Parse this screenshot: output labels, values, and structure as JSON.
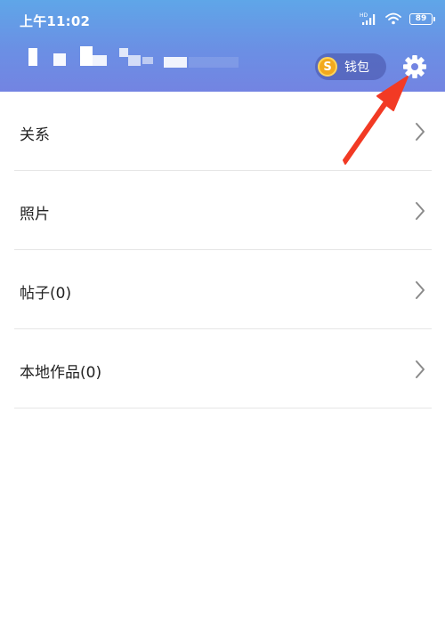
{
  "status_bar": {
    "time": "上午11:02",
    "battery": "89"
  },
  "header": {
    "wallet_label": "钱包",
    "coin_glyph": "S"
  },
  "menu": {
    "items": [
      {
        "label": "关系"
      },
      {
        "label": "照片"
      },
      {
        "label": "帖子(0)"
      },
      {
        "label": "本地作品(0)"
      }
    ]
  },
  "icons": {
    "settings": "gear-icon",
    "chevron": "chevron-right-icon",
    "signal": "signal-icon",
    "wifi": "wifi-icon",
    "battery": "battery-icon",
    "annotation": "red-arrow-annotation"
  },
  "colors": {
    "header_top": "#5fa6e8",
    "header_bottom": "#7384e2",
    "coin": "#f2a91d",
    "arrow": "#f23a24"
  }
}
